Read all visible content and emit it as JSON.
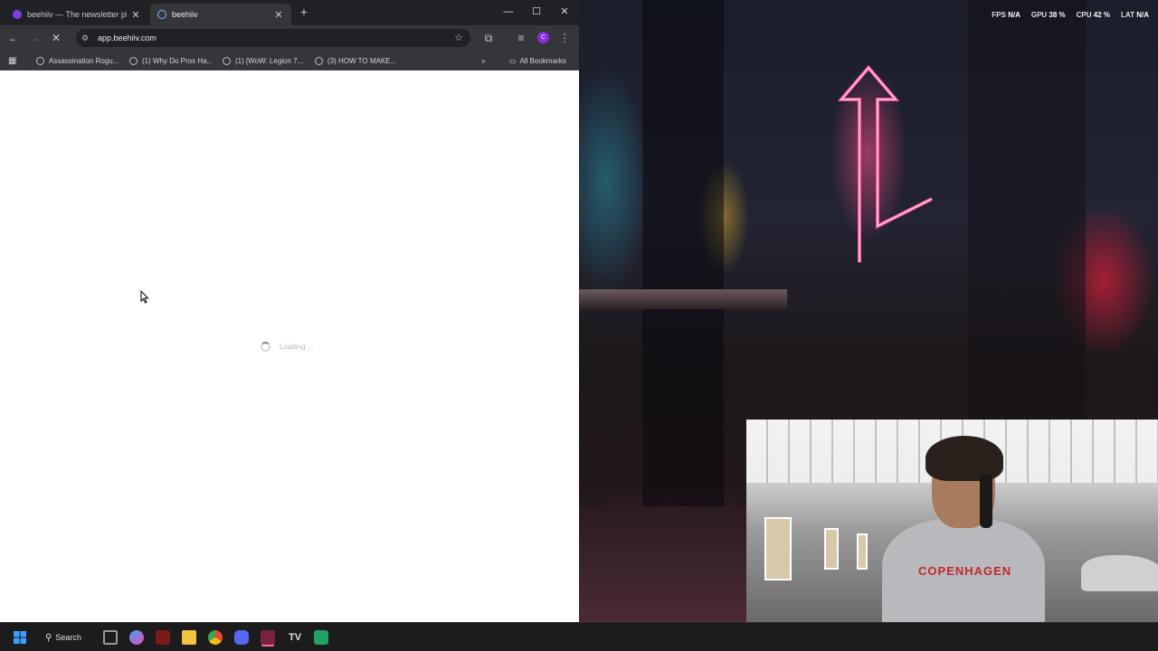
{
  "browser": {
    "tabs": [
      {
        "title": "beehiiv — The newsletter platf",
        "active": false
      },
      {
        "title": "beehiiv",
        "active": true
      }
    ],
    "url": "app.beehiiv.com",
    "profile_initial": "C",
    "bookmarks": [
      "Assassination Rogu...",
      "(1) Why Do Pros Ha...",
      "(1) [WoW: Legion 7...",
      "(3) HOW TO MAKE..."
    ],
    "all_bookmarks_label": "All Bookmarks",
    "loading_text": "Loading ..."
  },
  "stats": {
    "fps_label": "FPS",
    "fps_value": "N/A",
    "gpu_label": "GPU",
    "gpu_value": "38 %",
    "cpu_label": "CPU",
    "cpu_value": "42 %",
    "lat_label": "LAT",
    "lat_value": "N/A"
  },
  "webcam": {
    "hoodie_text": "COPENHAGEN"
  },
  "taskbar": {
    "search_label": "Search"
  },
  "colors": {
    "accent_purple": "#8a2be2",
    "neon_pink": "#ff3c8c",
    "tab_dark": "#202124"
  }
}
